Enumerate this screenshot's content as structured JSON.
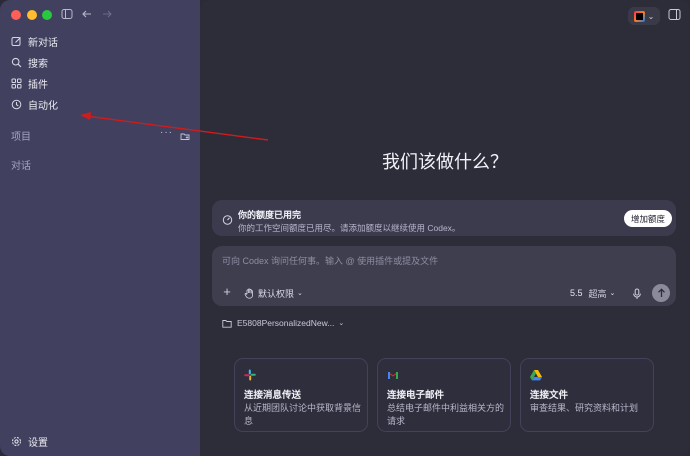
{
  "sidebar": {
    "items": [
      {
        "label": "新对话",
        "icon": "edit-icon"
      },
      {
        "label": "搜索",
        "icon": "search-icon"
      },
      {
        "label": "插件",
        "icon": "plugins-icon"
      },
      {
        "label": "自动化",
        "icon": "clock-icon"
      }
    ],
    "projects_label": "项目",
    "chats_label": "对话",
    "settings_label": "设置"
  },
  "main": {
    "headline": "我们该做什么？",
    "quota": {
      "title": "你的额度已用完",
      "description": "你的工作空间额度已用尽。请添加额度以继续使用 Codex。",
      "button": "增加额度"
    },
    "composer": {
      "placeholder": "可向 Codex 询问任何事。输入 @ 使用插件或提及文件",
      "permissions": "默认权限",
      "model": "5.5",
      "mode": "超高"
    },
    "project": "E5808PersonalizedNew...",
    "cards": [
      {
        "title": "连接消息传送",
        "description": "从近期团队讨论中获取背景信息",
        "icon": "slack-icon"
      },
      {
        "title": "连接电子邮件",
        "description": "总结电子邮件中利益相关方的请求",
        "icon": "gmail-icon"
      },
      {
        "title": "连接文件",
        "description": "审查结果、研究资料和计划",
        "icon": "google-drive-icon"
      }
    ]
  },
  "colors": {
    "sidebar_bg": "#41405e",
    "main_bg": "#2d2c39",
    "annotation_arrow": "#d01c1c"
  }
}
